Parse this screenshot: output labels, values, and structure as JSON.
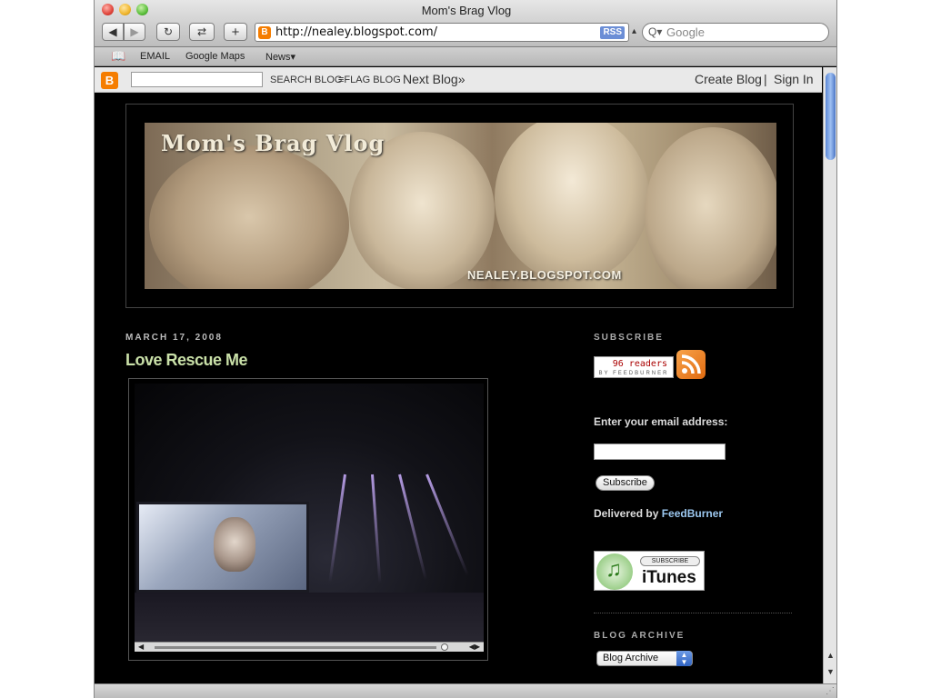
{
  "window": {
    "title": "Mom's Brag Vlog"
  },
  "toolbar": {
    "url": "http://nealey.blogspot.com/",
    "rss_badge": "RSS",
    "search_placeholder": "Google"
  },
  "bookmarks": [
    "EMAIL",
    "Google Maps",
    "News▾"
  ],
  "navbar": {
    "search_blog": "SEARCH BLOG",
    "flag_blog": "≡FLAG BLOG",
    "next_blog": "Next Blog»",
    "create_blog": "Create Blog",
    "separator": "|",
    "sign_in": "Sign In"
  },
  "header": {
    "banner_title": "Mom's Brag Vlog",
    "banner_url": "NEALEY.BLOGSPOT.COM"
  },
  "post": {
    "date": "MARCH 17, 2008",
    "title": "Love Rescue Me"
  },
  "sidebar": {
    "subscribe_heading": "SUBSCRIBE",
    "readers": "96 readers",
    "by_feedburner": "BY FEEDBURNER",
    "email_prompt": "Enter your email address:",
    "subscribe_button": "Subscribe",
    "delivered_by": "Delivered by ",
    "feedburner_link": "FeedBurner",
    "itunes_subscribe": "SUBSCRIBE",
    "itunes_name": "iTunes",
    "archive_heading": "BLOG ARCHIVE",
    "archive_select": "Blog Archive"
  },
  "colors": {
    "page_bg": "#000000",
    "post_title": "#c9e0a8",
    "link": "#9cc8f0",
    "blogger_orange": "#f57d00"
  }
}
